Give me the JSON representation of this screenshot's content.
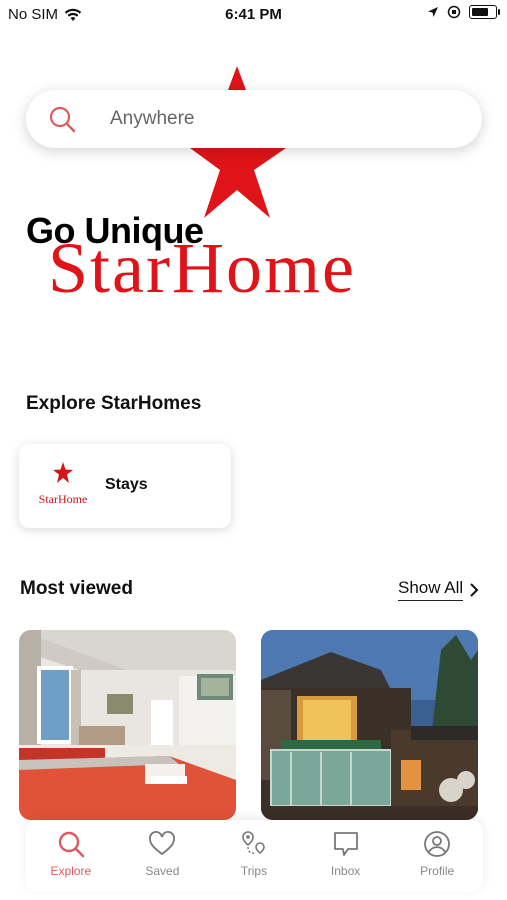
{
  "status_bar": {
    "carrier": "No SIM",
    "time": "6:41 PM",
    "battery_level": 0.8
  },
  "search": {
    "placeholder": "Anywhere"
  },
  "hero": {
    "brand": "StarHome",
    "tagline": "Go Unique"
  },
  "explore": {
    "title": "Explore StarHomes",
    "card": {
      "label": "Stays",
      "logo_text": "StarHome"
    }
  },
  "most_viewed": {
    "title": "Most viewed",
    "show_all": "Show All"
  },
  "tabs": [
    {
      "label": "Explore",
      "icon": "search-icon",
      "active": true
    },
    {
      "label": "Saved",
      "icon": "heart-icon",
      "active": false
    },
    {
      "label": "Trips",
      "icon": "map-pin-icon",
      "active": false
    },
    {
      "label": "Inbox",
      "icon": "chat-icon",
      "active": false
    },
    {
      "label": "Profile",
      "icon": "user-circle-icon",
      "active": false
    }
  ],
  "colors": {
    "accent": "#e0595e",
    "brand_red": "#e01418"
  }
}
